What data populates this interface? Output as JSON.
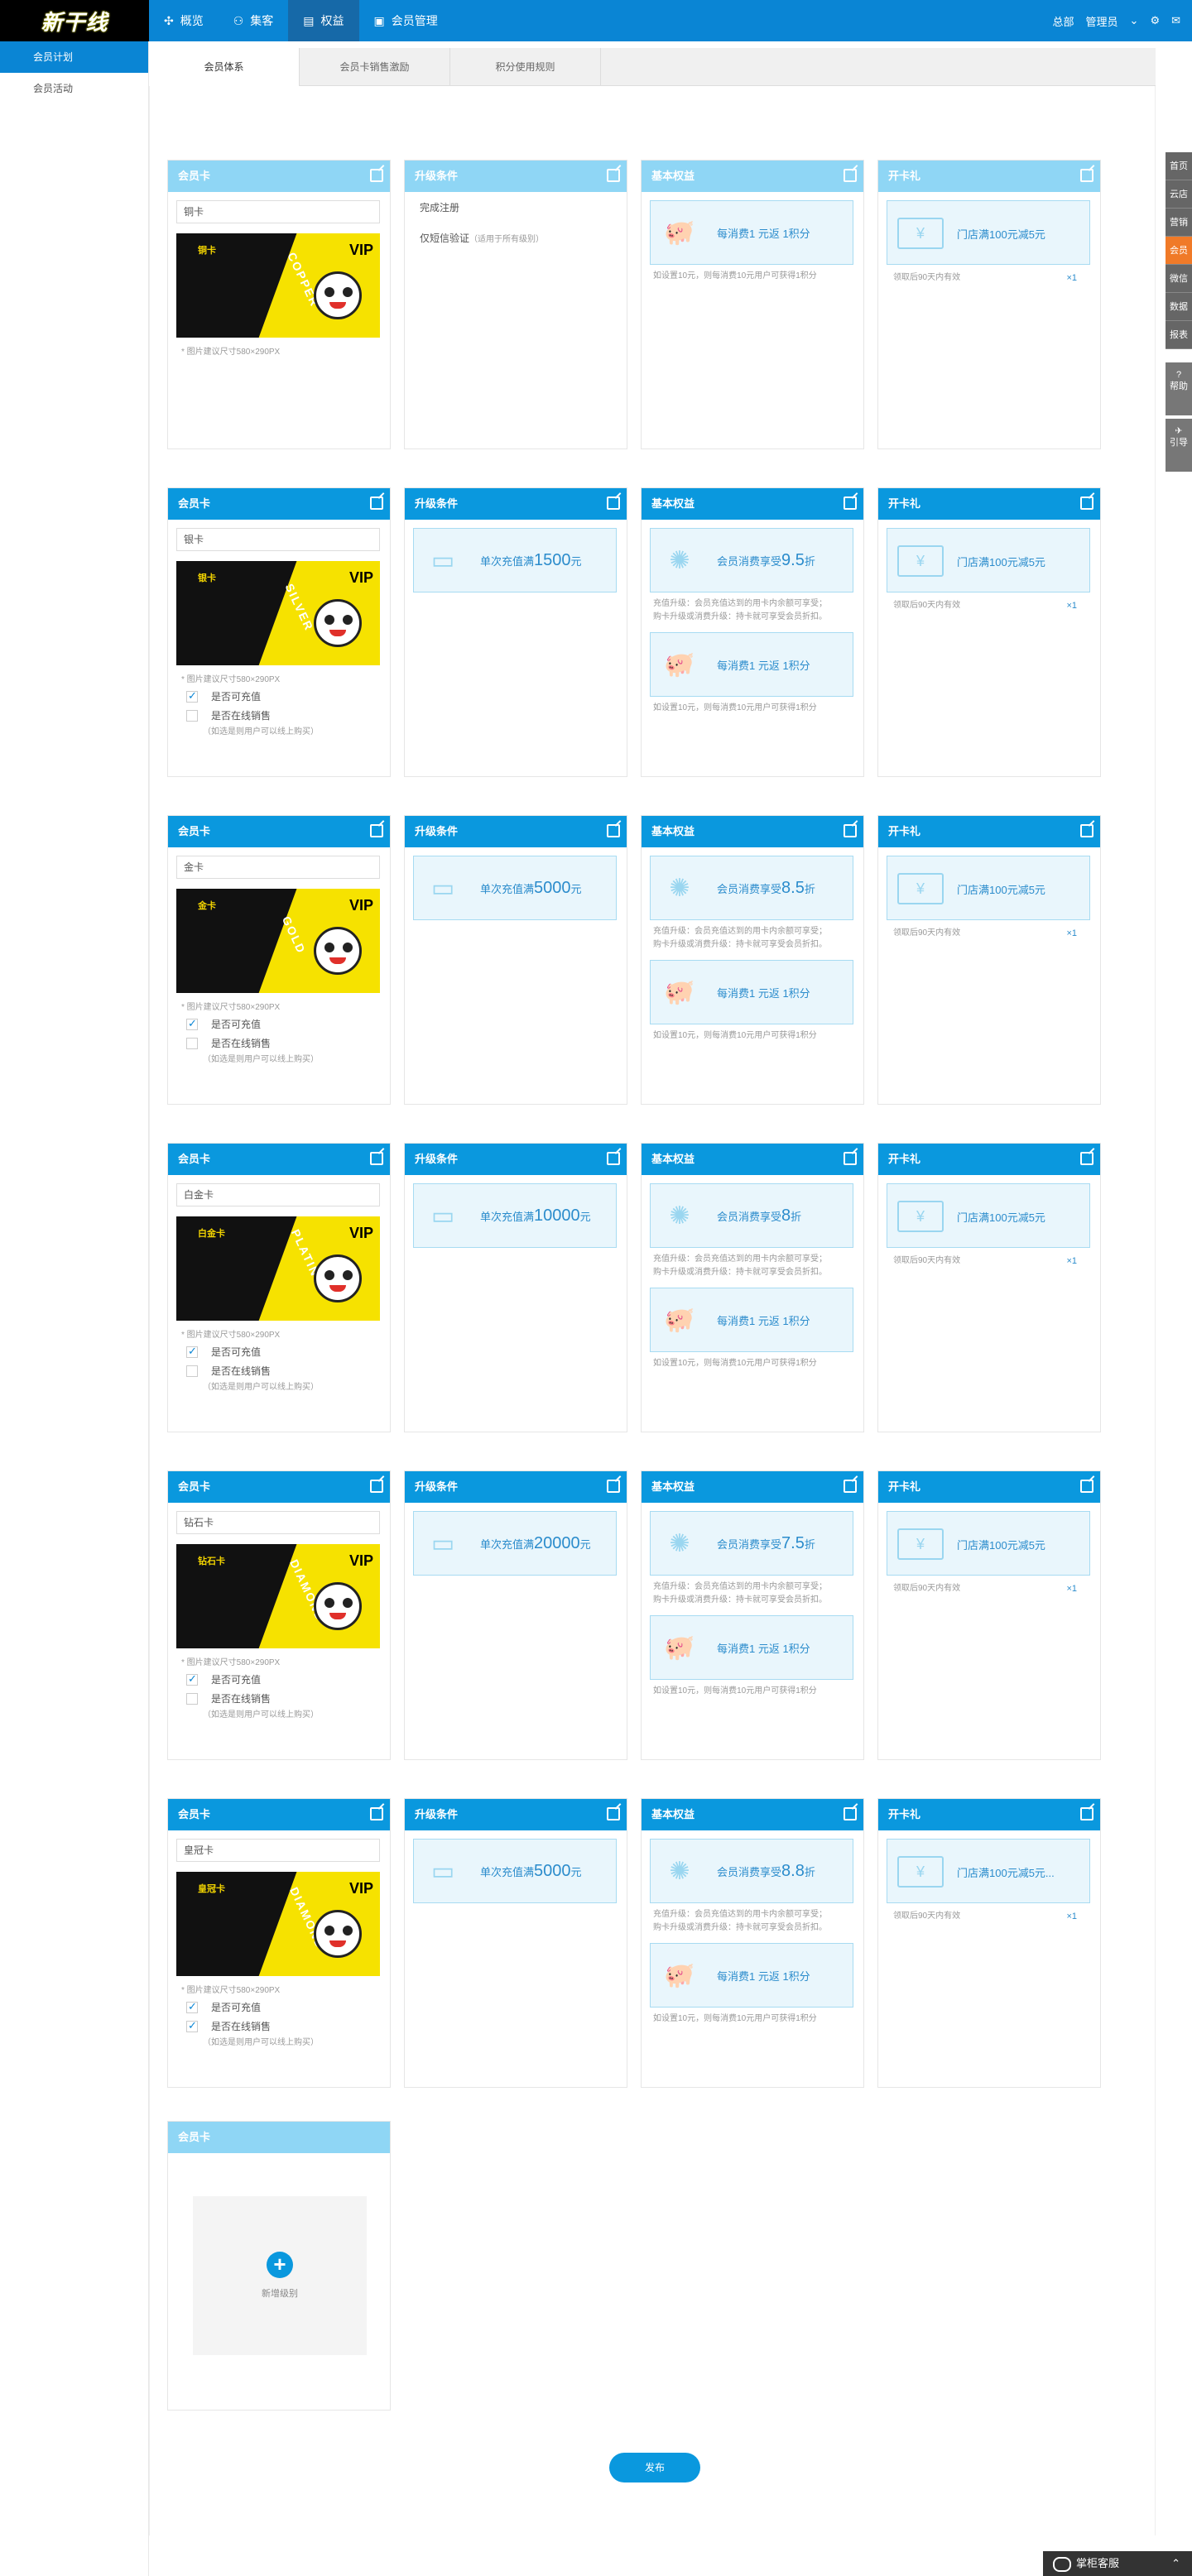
{
  "app": {
    "logo": "新干线"
  },
  "nav": [
    {
      "label": "概览",
      "icon": "overview-icon"
    },
    {
      "label": "集客",
      "icon": "customer-icon"
    },
    {
      "label": "权益",
      "icon": "rights-icon"
    },
    {
      "label": "会员管理",
      "icon": "member-icon"
    }
  ],
  "topright": {
    "org": "总部",
    "user": "管理员"
  },
  "sidebar": [
    "会员计划",
    "会员活动"
  ],
  "tabs": [
    "会员体系",
    "会员卡销售激励",
    "积分使用规则"
  ],
  "headers": {
    "card": "会员卡",
    "cond": "升级条件",
    "benefit": "基本权益",
    "gift": "开卡礼"
  },
  "common": {
    "img_hint": "* 图片建议尺寸580×290PX",
    "recharge": "是否可充值",
    "online": "是否在线销售",
    "online_hint": "（如选是则用户可以线上购买）",
    "points": "每消费1 元返 1积分",
    "points_desc": "如设置10元，则每消费10元用户可获得1积分",
    "discount_pre": "会员消费享受",
    "discount_suf": "折",
    "discount_desc1": "充值升级：会员充值达到的用卡内余额可享受；",
    "discount_desc2": "购卡升级或消费升级：持卡就可享受会员折扣。",
    "recharge_pre": "单次充值满",
    "recharge_suf": "元",
    "gift_desc": "领取后90天内有效",
    "gift_count": "×1",
    "vip": "VIP"
  },
  "levels": [
    {
      "name": "铜卡",
      "tier": "铜卡",
      "word": "COPPER",
      "cond1": "完成注册",
      "cond2": "仅短信验证",
      "cond2_note": "（适用于所有级别）",
      "gift": "门店满100元减5元"
    },
    {
      "name": "银卡",
      "tier": "银卡",
      "word": "SILVER",
      "amount": "1500",
      "discount": "9.5",
      "gift": "门店满100元减5元",
      "recharge": true,
      "online": false
    },
    {
      "name": "金卡",
      "tier": "金卡",
      "word": "GOLD",
      "amount": "5000",
      "discount": "8.5",
      "gift": "门店满100元减5元",
      "recharge": true,
      "online": false
    },
    {
      "name": "白金卡",
      "tier": "白金卡",
      "word": "PLATINUM",
      "amount": "10000",
      "discount": "8",
      "gift": "门店满100元减5元",
      "recharge": true,
      "online": false
    },
    {
      "name": "钻石卡",
      "tier": "钻石卡",
      "word": "DIAMOND",
      "amount": "20000",
      "discount": "7.5",
      "gift": "门店满100元减5元",
      "recharge": true,
      "online": false
    },
    {
      "name": "皇冠卡",
      "tier": "皇冠卡",
      "word": "DIAMOND",
      "amount": "5000",
      "discount": "8.8",
      "gift": "门店满100元减5元...",
      "recharge": true,
      "online": true
    }
  ],
  "add": {
    "header": "会员卡",
    "label": "新增级别"
  },
  "publish": "发布",
  "rightbar": [
    "首页",
    "云店",
    "营销",
    "会员",
    "微信",
    "数据",
    "报表"
  ],
  "rightbar_big": [
    "帮助",
    "引导"
  ],
  "service": "掌柜客服"
}
